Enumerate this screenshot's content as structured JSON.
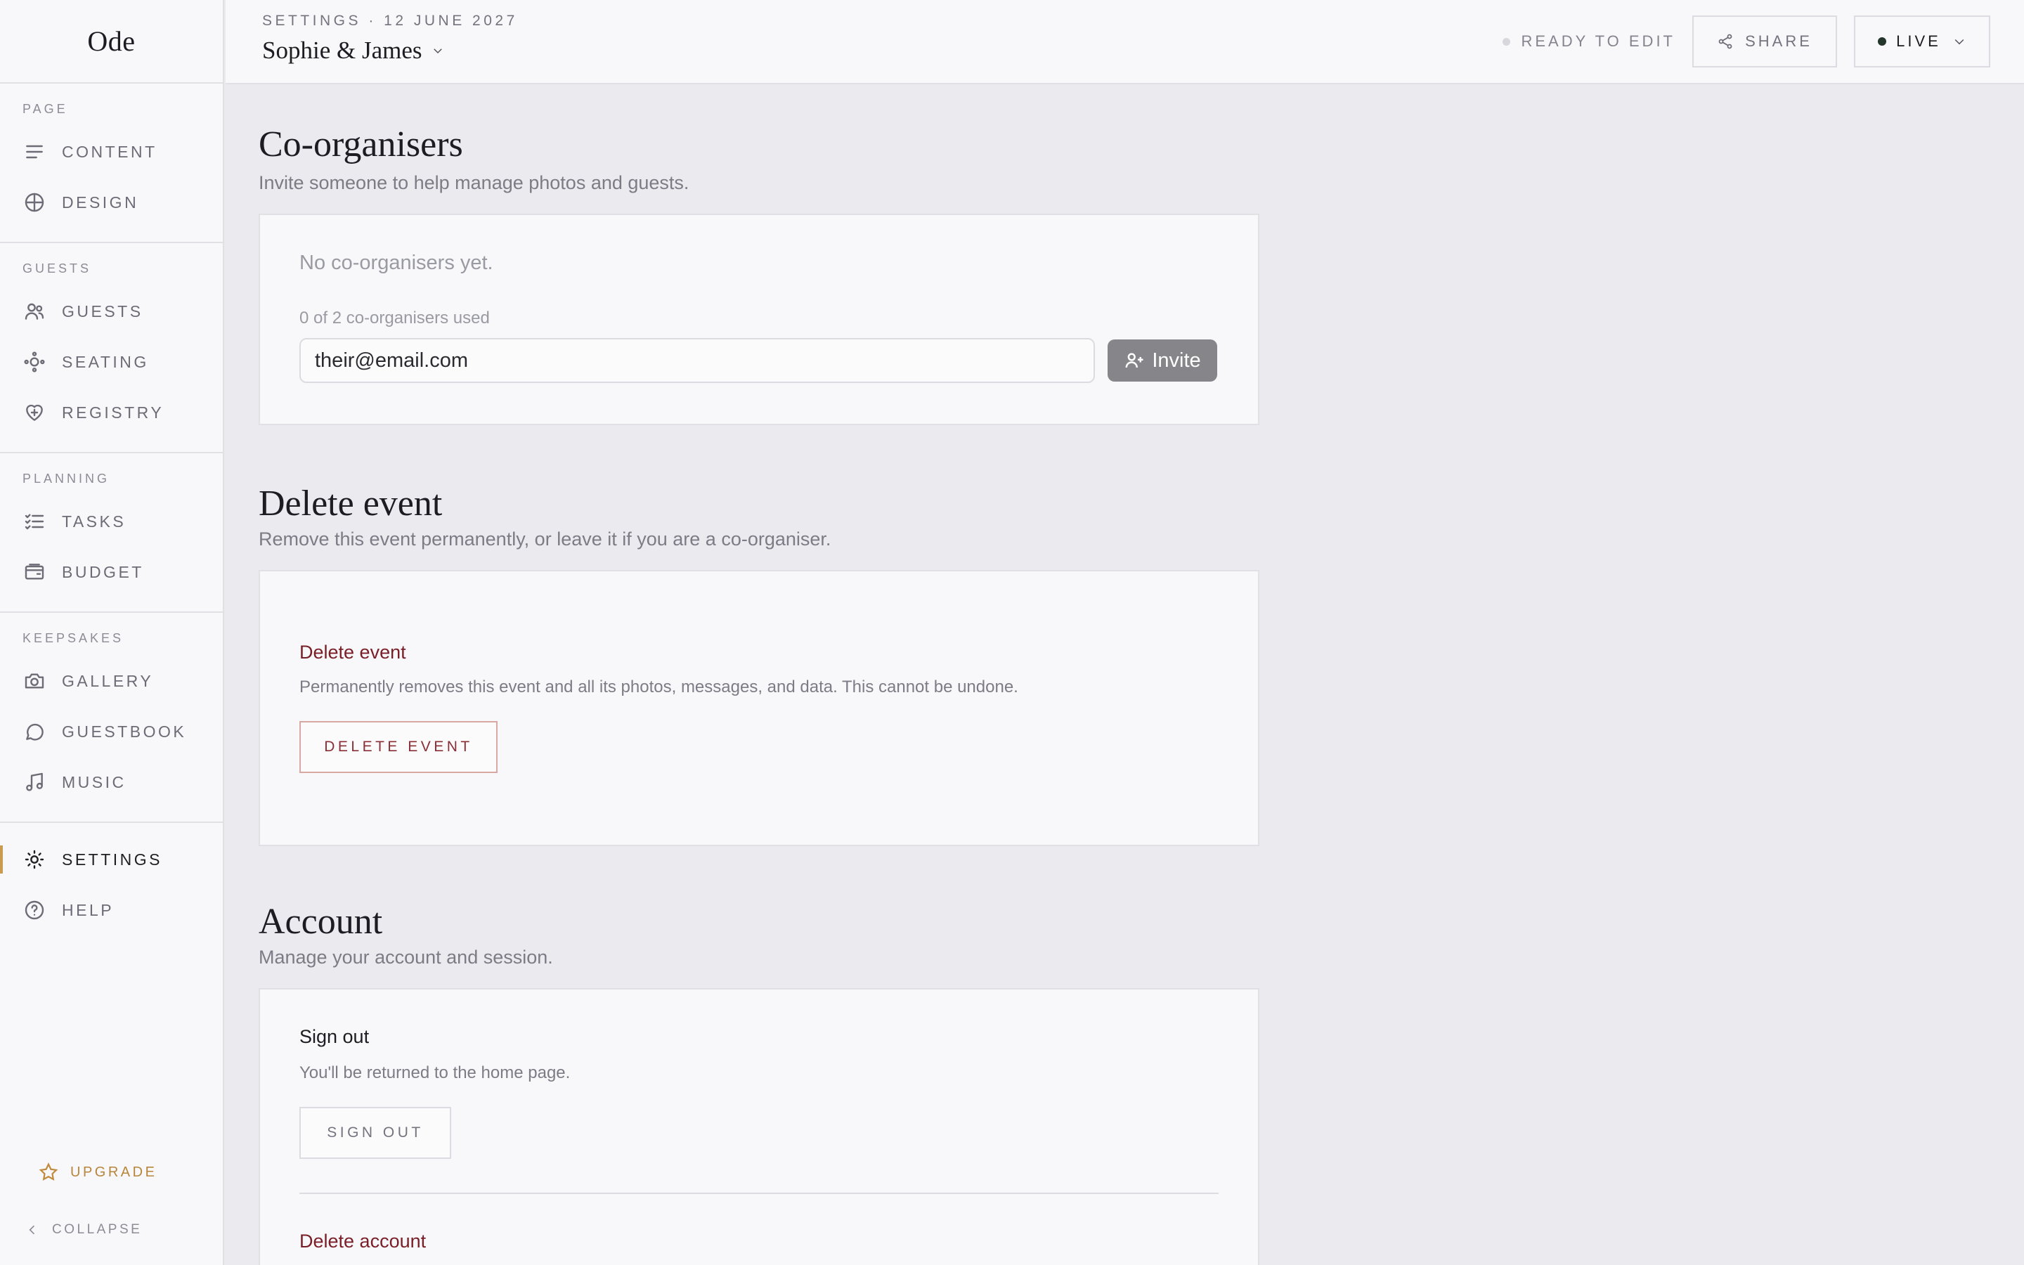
{
  "sidebar": {
    "logo": "Ode",
    "groups": [
      {
        "label": "PAGE",
        "items": [
          {
            "label": "CONTENT",
            "icon": "lines-icon"
          },
          {
            "label": "DESIGN",
            "icon": "globe-icon"
          }
        ]
      },
      {
        "label": "GUESTS",
        "items": [
          {
            "label": "GUESTS",
            "icon": "users-icon"
          },
          {
            "label": "SEATING",
            "icon": "seating-icon"
          },
          {
            "label": "REGISTRY",
            "icon": "heart-plus-icon"
          }
        ]
      },
      {
        "label": "PLANNING",
        "items": [
          {
            "label": "TASKS",
            "icon": "checklist-icon"
          },
          {
            "label": "BUDGET",
            "icon": "wallet-icon"
          }
        ]
      },
      {
        "label": "KEEPSAKES",
        "items": [
          {
            "label": "GALLERY",
            "icon": "camera-icon"
          },
          {
            "label": "GUESTBOOK",
            "icon": "message-icon"
          },
          {
            "label": "MUSIC",
            "icon": "music-icon"
          }
        ]
      }
    ],
    "settings": {
      "label": "SETTINGS",
      "icon": "sun-gear-icon",
      "active": true
    },
    "help": {
      "label": "HELP",
      "icon": "question-icon"
    },
    "upgrade": "UPGRADE",
    "collapse": "COLLAPSE",
    "accent_color": "#c99b4e"
  },
  "topbar": {
    "breadcrumb": "SETTINGS · 12 JUNE 2027",
    "event_name": "Sophie & James",
    "status": "READY TO EDIT",
    "share": "SHARE",
    "live": "LIVE"
  },
  "coorganisers": {
    "title": "Co-organisers",
    "subtitle": "Invite someone to help manage photos and guests.",
    "empty": "No co-organisers yet.",
    "usage": "0 of 2 co-organisers used",
    "email_value": "their@email.com",
    "invite": "Invite"
  },
  "delete_event": {
    "title": "Delete event",
    "subtitle": "Remove this event permanently, or leave it if you are a co-organiser.",
    "card_title": "Delete event",
    "card_desc": "Permanently removes this event and all its photos, messages, and data. This cannot be undone.",
    "button": "DELETE EVENT",
    "danger_color": "#7a1f28"
  },
  "account": {
    "title": "Account",
    "subtitle": "Manage your account and session.",
    "signout_title": "Sign out",
    "signout_desc": "You'll be returned to the home page.",
    "signout_button": "SIGN OUT",
    "delete_account_title": "Delete account"
  }
}
